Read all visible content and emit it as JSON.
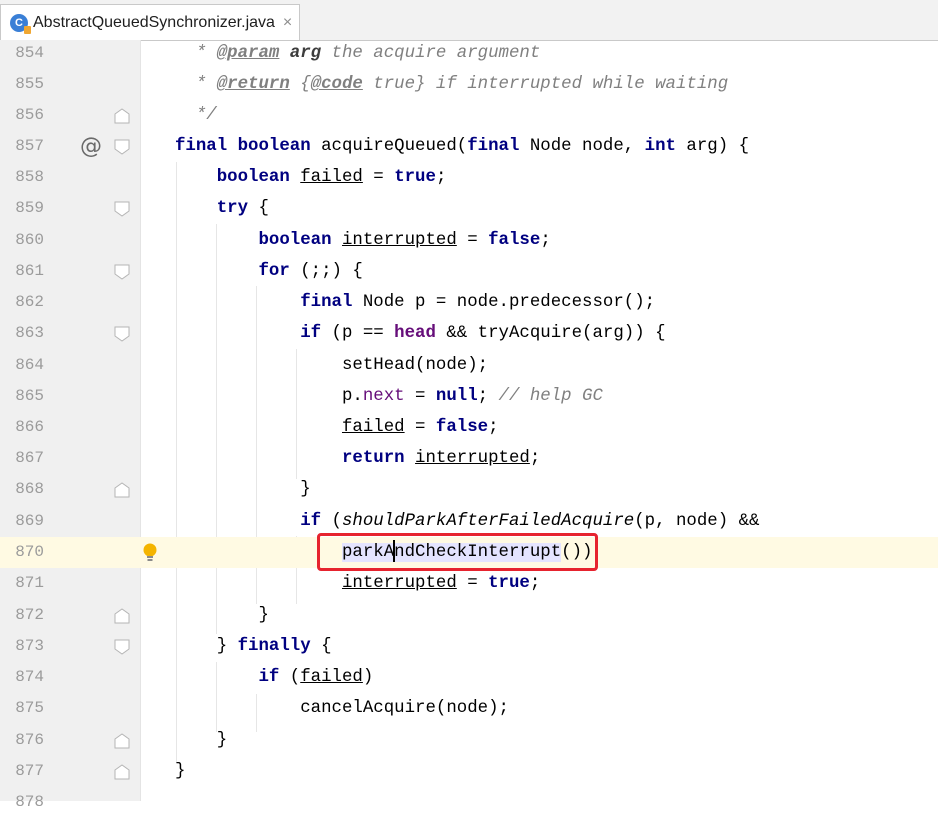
{
  "tab": {
    "icon_letter": "C",
    "filename": "AbstractQueuedSynchronizer.java",
    "close_glyph": "×"
  },
  "colors": {
    "keyword": "#000080",
    "field": "#660e7a",
    "comment": "#808080",
    "current_line": "#fffae3",
    "highlight_box": "#e6232e"
  },
  "lines": [
    {
      "number": "854",
      "text": " * @param arg the acquire argument"
    },
    {
      "number": "855",
      "text": " * @return {@code true} if interrupted while waiting"
    },
    {
      "number": "856",
      "text": " */"
    },
    {
      "number": "857",
      "text": "final boolean acquireQueued(final Node node, int arg) {"
    },
    {
      "number": "858",
      "text": "boolean failed = true;"
    },
    {
      "number": "859",
      "text": "try {"
    },
    {
      "number": "860",
      "text": "boolean interrupted = false;"
    },
    {
      "number": "861",
      "text": "for (;;) {"
    },
    {
      "number": "862",
      "text": "final Node p = node.predecessor();"
    },
    {
      "number": "863",
      "text": "if (p == head && tryAcquire(arg)) {"
    },
    {
      "number": "864",
      "text": "setHead(node);"
    },
    {
      "number": "865",
      "text": "p.next = null; // help GC"
    },
    {
      "number": "866",
      "text": "failed = false;"
    },
    {
      "number": "867",
      "text": "return interrupted;"
    },
    {
      "number": "868",
      "text": "}"
    },
    {
      "number": "869",
      "text": "if (shouldParkAfterFailedAcquire(p, node) &&"
    },
    {
      "number": "870",
      "text": "parkAndCheckInterrupt())"
    },
    {
      "number": "871",
      "text": "interrupted = true;"
    },
    {
      "number": "872",
      "text": "}"
    },
    {
      "number": "873",
      "text": "} finally {"
    },
    {
      "number": "874",
      "text": "if (failed)"
    },
    {
      "number": "875",
      "text": "cancelAcquire(node);"
    },
    {
      "number": "876",
      "text": "}"
    },
    {
      "number": "877",
      "text": "}"
    },
    {
      "number": "878",
      "text": ""
    }
  ],
  "gutter": {
    "override_marker": "@",
    "override_line": "857",
    "intention_bulb_line": "870",
    "current_line": "870"
  }
}
